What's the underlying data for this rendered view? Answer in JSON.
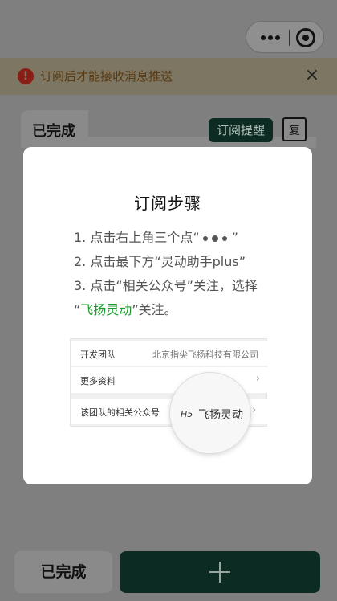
{
  "header": {
    "capsule": {
      "more_icon": "more-dots-icon",
      "close_icon": "target-circle-icon"
    }
  },
  "banner": {
    "icon": "alert-icon",
    "text": "订阅后才能接收消息推送",
    "close": "×"
  },
  "card": {
    "tab_label": "已完成",
    "subscribe_label": "订阅提醒",
    "copy_label": "复"
  },
  "modal": {
    "title": "订阅步骤",
    "step1_prefix": "1.  点击右上角三个点“",
    "step1_suffix": "”",
    "step2": "2.  点击最下方“灵动助手plus”",
    "step3_line1": "3.  点击“相关公众号”关注，选择",
    "step3_quote_open": "“",
    "step3_highlight": "飞扬灵动",
    "step3_quote_close": "”关注。",
    "illustration": {
      "row1_label": "开发团队",
      "row1_value": "北京指尖飞扬科技有限公司",
      "row2_label": "更多资料",
      "row3_label": "该团队的相关公众号",
      "chevron": "›",
      "mag_badge": "H5",
      "mag_name": "飞扬灵动"
    }
  },
  "footer": {
    "done_label": "已完成",
    "add_icon": "plus-icon"
  },
  "colors": {
    "overlay_bg": "#7f7f7f",
    "dark_green": "#0c2b23",
    "highlight_green": "#1a9b2d"
  }
}
